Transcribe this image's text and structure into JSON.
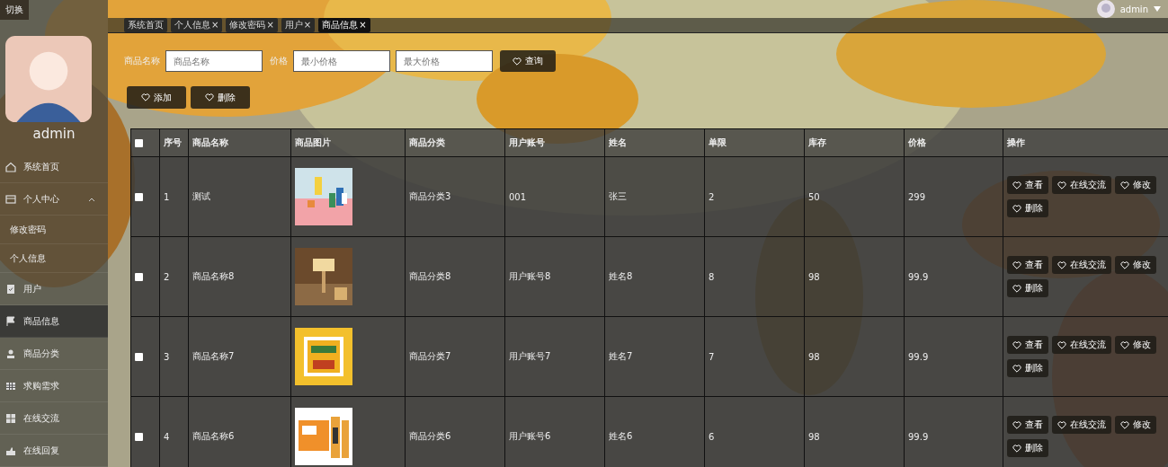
{
  "top_left": {
    "label": "切换"
  },
  "user_menu": {
    "name": "admin"
  },
  "tabs": [
    {
      "label": "系统首页",
      "selected": false
    },
    {
      "label": "个人信息",
      "close": "×",
      "selected": false
    },
    {
      "label": "修改密码",
      "close": "×",
      "selected": false
    },
    {
      "label": "用户",
      "close": "×",
      "selected": false
    },
    {
      "label": "商品信息",
      "close": "×",
      "selected": true
    }
  ],
  "sidebar": {
    "user": "admin",
    "items": [
      {
        "label": "系统首页",
        "selected": false
      },
      {
        "label": "个人中心",
        "selected": false,
        "expanded": true,
        "children": [
          {
            "label": "修改密码",
            "selected": false
          },
          {
            "label": "个人信息",
            "selected": false
          }
        ]
      },
      {
        "label": "用户",
        "selected": false
      },
      {
        "label": "商品信息",
        "selected": true
      },
      {
        "label": "商品分类",
        "selected": false
      },
      {
        "label": "求购需求",
        "selected": false
      },
      {
        "label": "在线交流",
        "selected": false
      },
      {
        "label": "在线回复",
        "selected": false
      }
    ]
  },
  "search": {
    "name_label": "商品名称",
    "name_placeholder": "商品名称",
    "price_label": "价格",
    "min_placeholder": "最小价格",
    "max_placeholder": "最大价格",
    "button": "查询"
  },
  "toolbar": [
    "添加",
    "删除"
  ],
  "table": {
    "select_all": {
      "checked": false
    },
    "columns": [
      "序号",
      "商品名称",
      "商品图片",
      "商品分类",
      "用户账号",
      "姓名",
      "单限",
      "库存",
      "价格",
      "操作"
    ],
    "rows": [
      {
        "checked": false,
        "cells": [
          "1",
          "测试",
          {
            "kind": "picture"
          },
          "商品分类3",
          "001",
          "张三",
          "2",
          "50",
          "299"
        ],
        "actions": [
          "查看",
          "在线交流",
          "修改",
          "删除"
        ]
      },
      {
        "checked": false,
        "cells": [
          "2",
          "商品名称8",
          {
            "kind": "picture"
          },
          "商品分类8",
          "用户账号8",
          "姓名8",
          "8",
          "98",
          "99.9"
        ],
        "actions": [
          "查看",
          "在线交流",
          "修改",
          "删除"
        ]
      },
      {
        "checked": false,
        "cells": [
          "3",
          "商品名称7",
          {
            "kind": "picture"
          },
          "商品分类7",
          "用户账号7",
          "姓名7",
          "7",
          "98",
          "99.9"
        ],
        "actions": [
          "查看",
          "在线交流",
          "修改",
          "删除"
        ]
      },
      {
        "checked": false,
        "cells": [
          "4",
          "商品名称6",
          {
            "kind": "picture"
          },
          "商品分类6",
          "用户账号6",
          "姓名6",
          "6",
          "98",
          "99.9"
        ],
        "actions": [
          "查看",
          "在线交流",
          "修改",
          "删除"
        ]
      }
    ]
  }
}
